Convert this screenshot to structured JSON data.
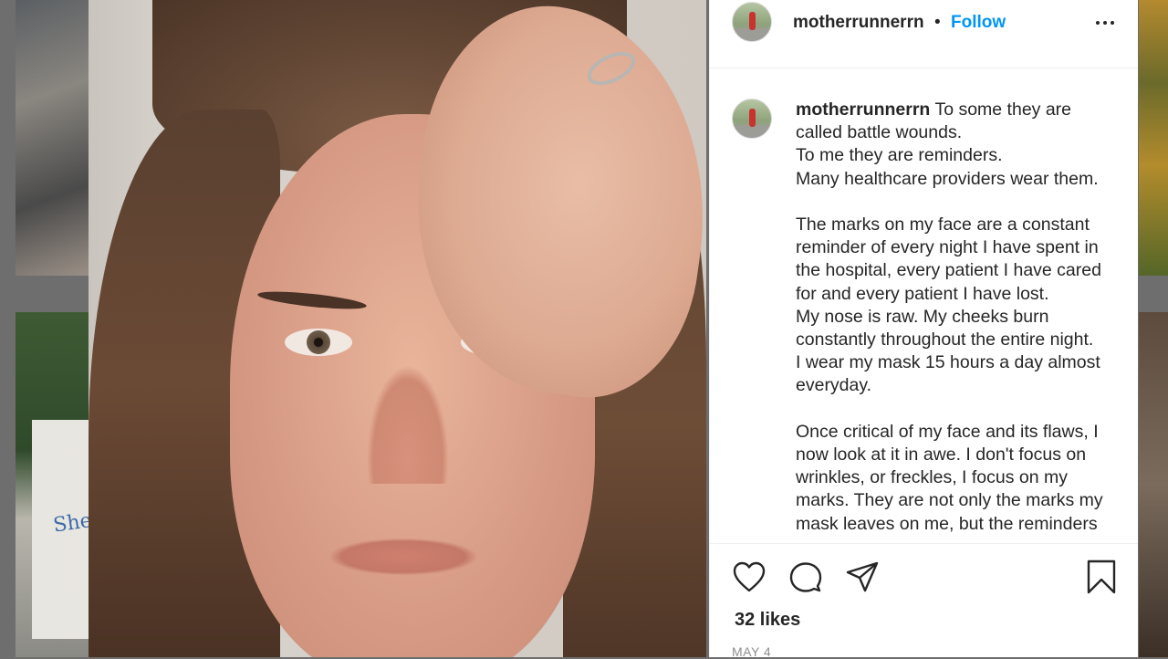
{
  "background_feed": {
    "sign_text": "She is New"
  },
  "post": {
    "username": "motherrunnerrn",
    "separator": "•",
    "follow_label": "Follow",
    "caption_lines": [
      "To some they are",
      "called battle wounds.",
      "To me they are reminders.",
      "Many healthcare providers wear them.",
      "",
      "The marks on my face are a constant",
      "reminder of every night I have spent in",
      "the hospital, every patient I have cared",
      "for and every patient I have lost.",
      "My nose is raw. My cheeks burn",
      "constantly throughout the entire night.",
      "I wear my mask 15 hours a day almost",
      "everyday.",
      "",
      "Once critical of my face and its flaws, I",
      "now look at it in awe. I don't focus on",
      "wrinkles, or freckles, I focus on my",
      "marks. They are not only the marks my",
      "mask leaves on me, but the reminders"
    ],
    "likes": "32 likes",
    "date": "MAY 4"
  },
  "icons": {
    "like": "heart-icon",
    "comment": "comment-icon",
    "share": "paper-plane-icon",
    "save": "bookmark-icon",
    "more": "more-options-icon"
  },
  "colors": {
    "follow_blue": "#0095f6",
    "text": "#262626",
    "muted": "#8e8e8e",
    "border": "#efefef"
  }
}
